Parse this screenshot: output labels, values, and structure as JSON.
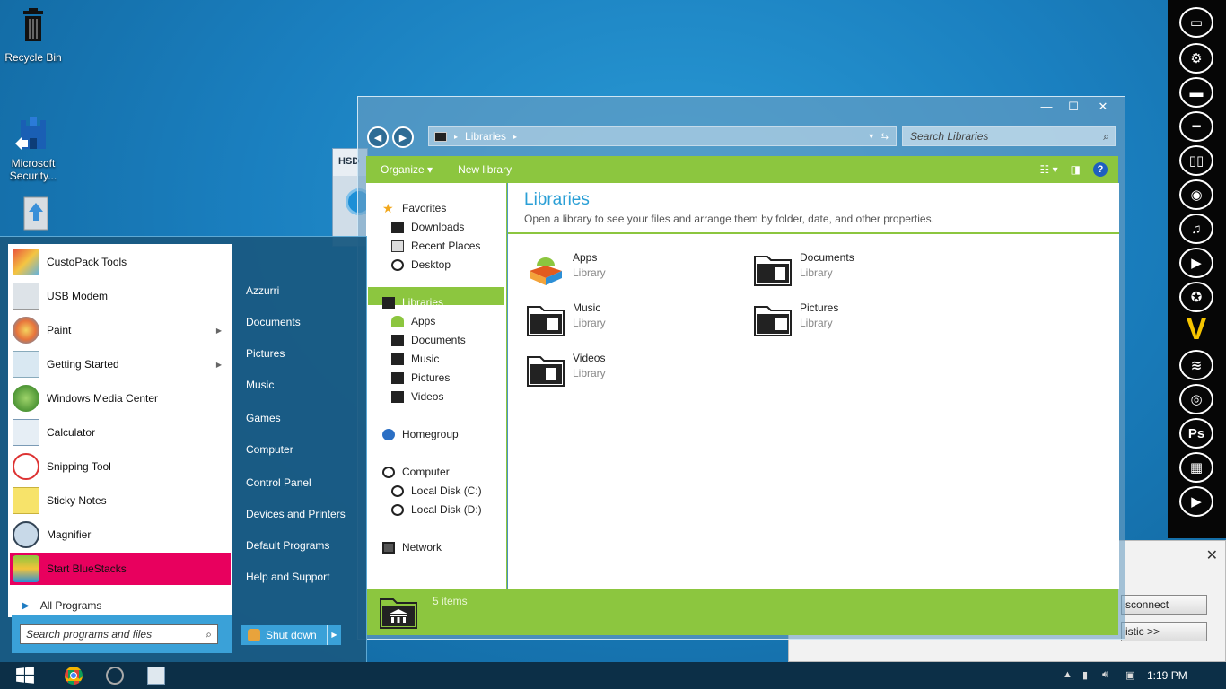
{
  "desktop": {
    "icons": [
      {
        "label": "Recycle Bin",
        "icon": "trash-icon"
      },
      {
        "label": "Microsoft\nSecurity...",
        "icon": "security-castle-icon"
      },
      {
        "label": "",
        "icon": "usb-modem-icon"
      }
    ]
  },
  "background_window": {
    "title": "HSD"
  },
  "explorer": {
    "window_controls": {
      "minimize": "—",
      "maximize": "☐",
      "close": "✕"
    },
    "address": {
      "crumb": "Libraries"
    },
    "search_placeholder": "Search Libraries",
    "toolbar": {
      "organize": "Organize ▾",
      "new_library": "New library"
    },
    "nav": {
      "favorites": "Favorites",
      "downloads": "Downloads",
      "recent_places": "Recent Places",
      "desktop": "Desktop",
      "libraries": "Libraries",
      "apps": "Apps",
      "documents": "Documents",
      "music": "Music",
      "pictures": "Pictures",
      "videos": "Videos",
      "homegroup": "Homegroup",
      "computer": "Computer",
      "local_c": "Local Disk (C:)",
      "local_d": "Local Disk (D:)",
      "network": "Network"
    },
    "content": {
      "title": "Libraries",
      "subtitle": "Open a library to see your files and arrange them by folder, date, and other properties.",
      "items": [
        {
          "name": "Apps",
          "type": "Library"
        },
        {
          "name": "Documents",
          "type": "Library"
        },
        {
          "name": "Music",
          "type": "Library"
        },
        {
          "name": "Pictures",
          "type": "Library"
        },
        {
          "name": "Videos",
          "type": "Library"
        }
      ]
    },
    "status": {
      "count": "5 items"
    }
  },
  "toast": {
    "close": "✕",
    "btn1": "sconnect",
    "btn2": "istic    >>"
  },
  "start_menu": {
    "programs": [
      {
        "label": "CustoPack Tools",
        "submenu": false
      },
      {
        "label": "USB Modem",
        "submenu": false
      },
      {
        "label": "Paint",
        "submenu": true
      },
      {
        "label": "Getting Started",
        "submenu": true
      },
      {
        "label": "Windows Media Center",
        "submenu": false
      },
      {
        "label": "Calculator",
        "submenu": false
      },
      {
        "label": "Snipping Tool",
        "submenu": false
      },
      {
        "label": "Sticky Notes",
        "submenu": false
      },
      {
        "label": "Magnifier",
        "submenu": false
      },
      {
        "label": "Start BlueStacks",
        "submenu": false
      }
    ],
    "all_programs": "All Programs",
    "search_placeholder": "Search programs and files",
    "right": [
      "Azzurri",
      "Documents",
      "Pictures",
      "Music",
      "Games",
      "Computer",
      "Control Panel",
      "Devices and Printers",
      "Default Programs",
      "Help and Support"
    ],
    "shutdown": "Shut down"
  },
  "taskbar": {
    "clock": "1:19 PM"
  },
  "colors": {
    "accent_green": "#8cc63f",
    "accent_blue": "#2a9fd6",
    "highlight_pink": "#e8005e"
  }
}
